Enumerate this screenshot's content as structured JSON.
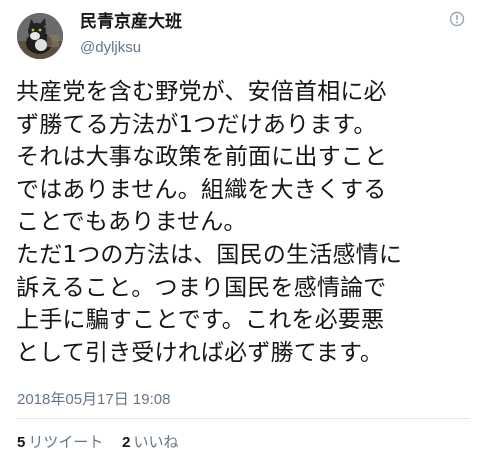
{
  "author": {
    "display_name": "民青京産大班",
    "handle": "@dyljksu",
    "avatar_icon": "cat-avatar-icon"
  },
  "menu_icon": "caret-down-icon",
  "tweet": {
    "lines": [
      "共産党を含む野党が、安倍首相に必",
      "ず勝てる方法が1つだけあります。",
      "それは大事な政策を前面に出すこと",
      "ではありません。組織を大きくする",
      "ことでもありません。",
      "ただ1つの方法は、国民の生活感情に",
      "訴えること。つまり国民を感情論で",
      "上手に騙すことです。これを必要悪",
      "として引き受ければ必ず勝てます。"
    ]
  },
  "timestamp": "2018年05月17日 19:08",
  "stats": {
    "retweets": {
      "count": "5",
      "label": "リツイート"
    },
    "likes": {
      "count": "2",
      "label": "いいね"
    }
  },
  "colors": {
    "text": "#14171a",
    "secondary": "#657786",
    "divider": "#e1e8ed"
  }
}
